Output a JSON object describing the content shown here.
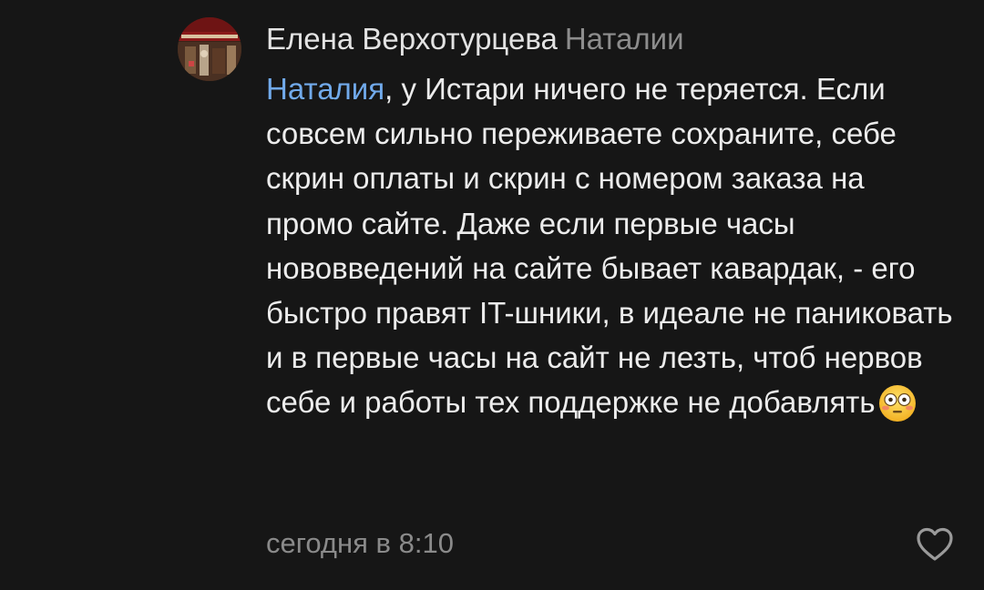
{
  "comment": {
    "author": "Елена Верхотурцева",
    "reply_to": "Наталии",
    "mention": "Наталия",
    "text": ", у Истари ничего не теряется. Если совсем сильно переживаете сохраните, себе скрин оплаты и скрин с номером заказа на промо сайте. Даже если первые часы нововведений на сайте бывает кавардак, - его быстро правят IT-шники, в идеале не паниковать и в первые часы на сайт не лезть, чтоб нервов себе и работы тех поддержке не добавлять",
    "emoji": "flushed-face",
    "timestamp": "сегодня в 8:10"
  },
  "icons": {
    "like": "heart-outline-icon"
  },
  "colors": {
    "background": "#161616",
    "text": "#ececec",
    "secondary": "#8a8a8a",
    "mention": "#71aaeb"
  }
}
